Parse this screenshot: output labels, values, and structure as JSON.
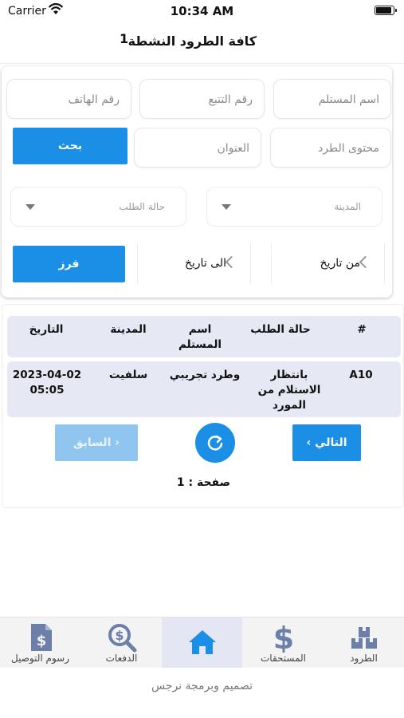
{
  "status_bar": {
    "carrier": "Carrier",
    "time": "10:34 AM"
  },
  "header": {
    "title": "كافة الطرود النشطة",
    "count": "1"
  },
  "search": {
    "recipient_name_placeholder": "اسم المستلم",
    "tracking_number_placeholder": "رقم التتبع",
    "phone_placeholder": "رقم الهاتف",
    "parcel_content_placeholder": "محتوى الطرد",
    "address_placeholder": "العنوان",
    "search_label": "بحث",
    "city_label": "المدينة",
    "order_status_label": "حالة الطلب",
    "from_date_label": "من تاريخ",
    "to_date_label": "الى تاريخ",
    "sort_label": "فرز"
  },
  "table": {
    "headers": {
      "id": "#",
      "status": "حالة الطلب",
      "recipient": "اسم المستلم",
      "city": "المدينة",
      "date": "التاريخ"
    },
    "rows": [
      {
        "id": "A10",
        "status": "بانتظار الاستلام من المورد",
        "recipient": "وطرد تجريبي",
        "city": "سلفيت",
        "date": "2023-04-02 05:05"
      }
    ]
  },
  "pager": {
    "next_label": "التالي",
    "prev_label": "السابق",
    "page_info": "صفحة : 1"
  },
  "tabs": [
    {
      "label": "الطرود",
      "icon": "parcels-icon"
    },
    {
      "label": "المستحقات",
      "icon": "dollar-icon"
    },
    {
      "label": "",
      "icon": "home-icon"
    },
    {
      "label": "الدفعات",
      "icon": "payments-search-icon"
    },
    {
      "label": "رسوم التوصيل",
      "icon": "delivery-fees-document-icon"
    }
  ],
  "footer": {
    "text": "تصميم وبرمجة نرجس"
  },
  "colors": {
    "accent": "#1b8fe6",
    "accent_disabled": "#8fc5ee",
    "tab_icon": "#6b7fa8",
    "row_bg": "#e6e9f4"
  }
}
